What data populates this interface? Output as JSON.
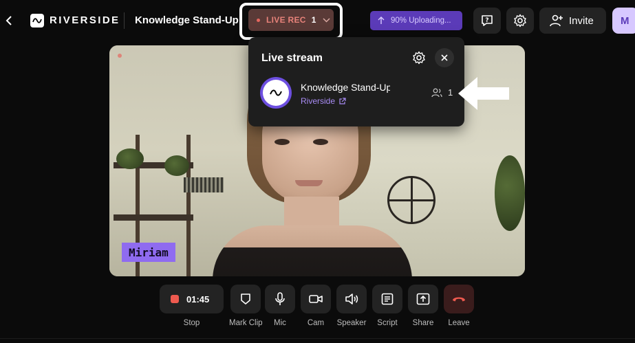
{
  "header": {
    "brand": "RIVERSIDE",
    "session_title": "Knowledge Stand-Up",
    "live_rec": {
      "label": "LIVE REC",
      "count": "1"
    },
    "upload_status": "90% Uploading...",
    "invite_label": "Invite",
    "avatar_initial": "M"
  },
  "video": {
    "participant_name": "Miriam"
  },
  "live_stream_popover": {
    "title": "Live stream",
    "stream": {
      "name": "Knowledge Stand-Up",
      "platform_link": "Riverside",
      "viewer_count": "1"
    }
  },
  "controls": {
    "timer": "01:45",
    "stop_label": "Stop",
    "mark_clip_label": "Mark Clip",
    "mic_label": "Mic",
    "cam_label": "Cam",
    "speaker_label": "Speaker",
    "script_label": "Script",
    "share_label": "Share",
    "leave_label": "Leave"
  },
  "colors": {
    "accent_purple": "#8f6bf0",
    "live_red": "#e5675f",
    "background": "#0b0b0b",
    "button_bg": "#232323"
  },
  "icons": [
    "back-icon",
    "riverside-logo-icon",
    "chevron-down-icon",
    "upload-arrow-icon",
    "feedback-icon",
    "gear-icon",
    "add-user-icon",
    "close-icon",
    "external-link-icon",
    "users-icon",
    "arrow-left-annotation-icon",
    "stop-icon",
    "shield-icon",
    "mic-icon",
    "camera-icon",
    "speaker-icon",
    "script-icon",
    "share-icon",
    "leave-phone-icon"
  ]
}
